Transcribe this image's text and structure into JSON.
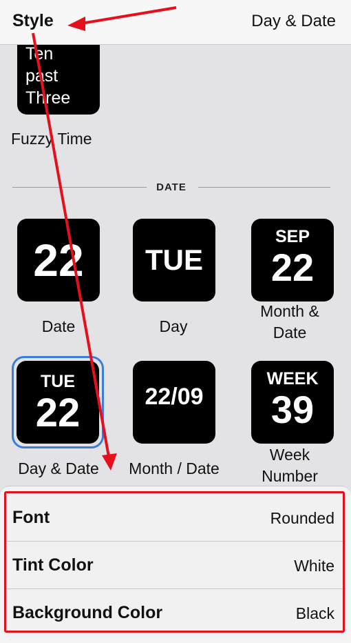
{
  "header": {
    "title": "Style",
    "right_label": "Day & Date"
  },
  "fuzzy": {
    "lines": [
      "Ten",
      "past",
      "Three"
    ],
    "caption": "Fuzzy Time"
  },
  "section": {
    "label": "DATE"
  },
  "tiles": [
    {
      "big": "22",
      "caption": "Date"
    },
    {
      "big": "TUE",
      "caption": "Day"
    },
    {
      "small": "SEP",
      "big": "22",
      "caption_lines": [
        "Month &",
        "Date"
      ]
    },
    {
      "small": "TUE",
      "big": "22",
      "caption": "Day & Date",
      "selected": true
    },
    {
      "big": "22/09",
      "caption": "Month / Date"
    },
    {
      "small": "WEEK",
      "big": "39",
      "caption_lines": [
        "Week",
        "Number"
      ]
    }
  ],
  "settings": [
    {
      "label": "Font",
      "value": "Rounded"
    },
    {
      "label": "Tint Color",
      "value": "White"
    },
    {
      "label": "Background Color",
      "value": "Black"
    }
  ],
  "colors": {
    "annotation": "#e5101c",
    "selection": "#3b7ddd",
    "tile": "#000000"
  }
}
